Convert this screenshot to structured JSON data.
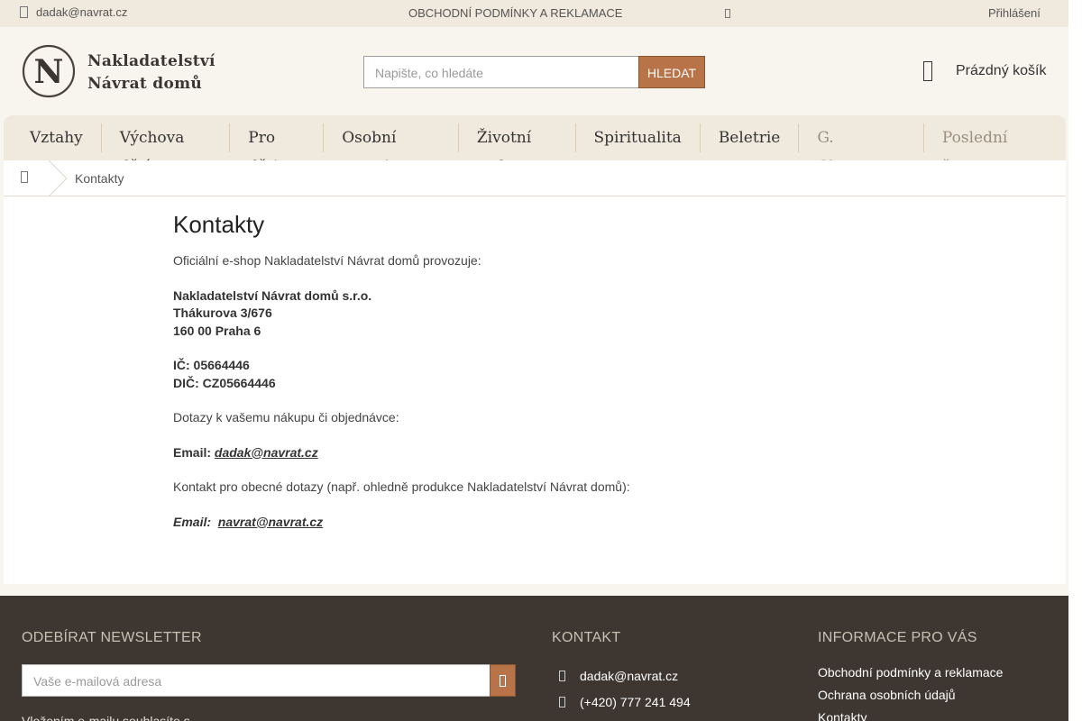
{
  "topbar": {
    "email": "dadak@navrat.cz",
    "terms": "OBCHODNÍ PODMÍNKY A REKLAMACE",
    "login": "Přihlášení"
  },
  "header": {
    "logo_letter": "N",
    "logo_line1": "Nakladatelství",
    "logo_line2": "Návrat domů",
    "search_placeholder": "Napište, co hledáte",
    "search_button": "HLEDAT",
    "cart_label": "Prázdný košík"
  },
  "nav": {
    "items": [
      {
        "label": "Vztahy"
      },
      {
        "label": "Výchova dětí"
      },
      {
        "label": "Pro děti"
      },
      {
        "label": "Osobní rozvoj"
      },
      {
        "label": "Životní styl"
      },
      {
        "label": "Spiritualita"
      },
      {
        "label": "Beletrie"
      },
      {
        "label": "G. Chapman"
      },
      {
        "label": "Poslední šance"
      }
    ]
  },
  "breadcrumb": {
    "current": "Kontakty"
  },
  "main": {
    "title": "Kontakty",
    "intro": "Oficiální e-shop Nakladatelství Návrat domů provozuje:",
    "company": "Nakladatelství Návrat domů s.r.o.",
    "street": "Thákurova 3/676",
    "city": "160 00 Praha 6",
    "ic": "IČ: 05664446",
    "dic": "DIČ: CZ05664446",
    "orders_text": "Dotazy k vašemu nákupu či objednávce:",
    "email_label": "Email:",
    "orders_email": "dadak@navrat.cz",
    "general_text": "Kontakt pro obecné dotazy (např. ohledně produkce Nakladatelství Návrat domů):",
    "email_label2": "Email:",
    "general_email": "navrat@navrat.cz"
  },
  "footer": {
    "newsletter_title": "ODEBÍRAT NEWSLETTER",
    "newsletter_placeholder": "Vaše e-mailová adresa",
    "newsletter_note": "Vložením e-mailu souhlasíte s",
    "contact_title": "KONTAKT",
    "contact_email": "dadak@navrat.cz",
    "contact_phone": "(+420) 777 241 494",
    "info_title": "INFORMACE PRO VÁS",
    "info_links": [
      {
        "label": "Obchodní podmínky a reklamace"
      },
      {
        "label": "Ochrana osobních údajů"
      },
      {
        "label": "Kontakty"
      }
    ]
  }
}
